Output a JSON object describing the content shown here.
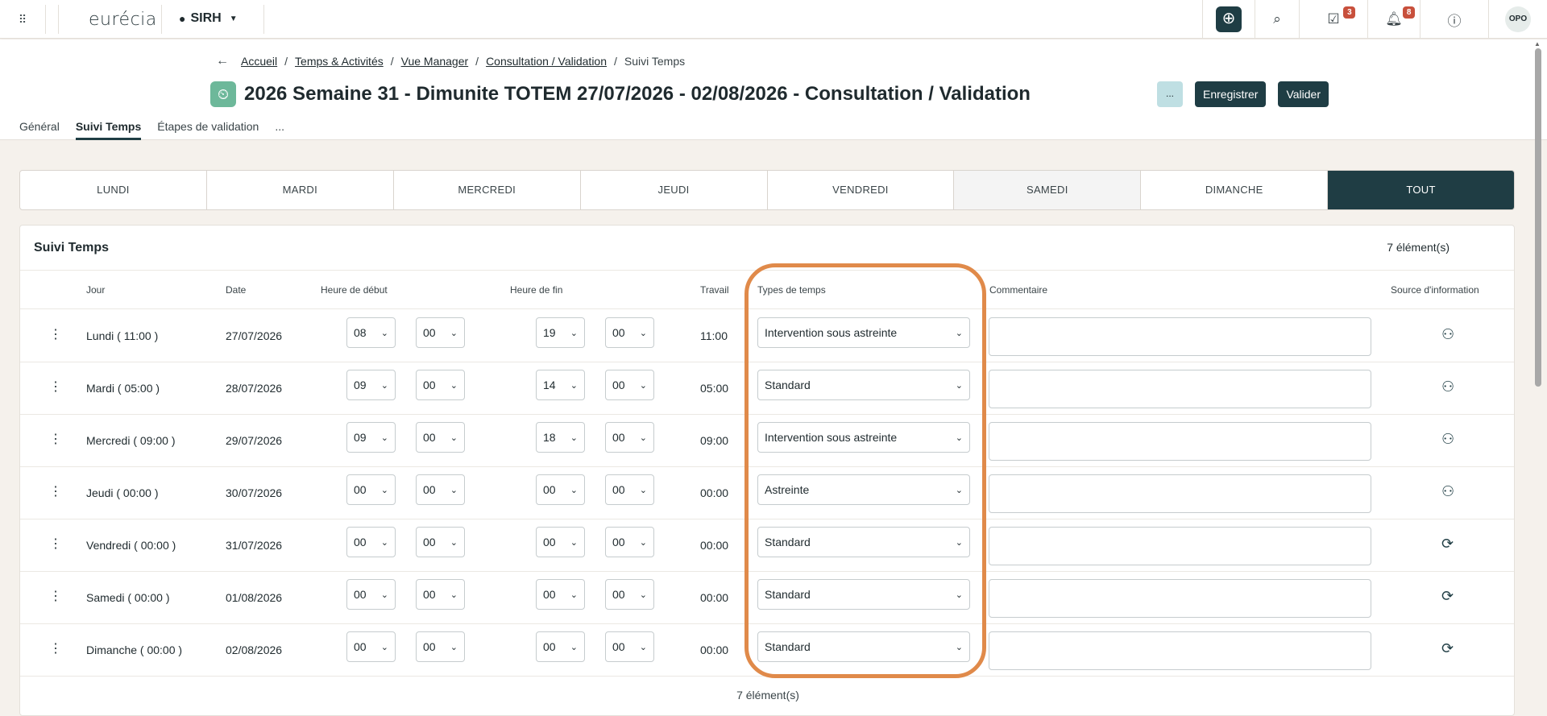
{
  "topbar": {
    "logo": "eurécia",
    "module": "SIRH",
    "tasks_badge": "3",
    "notif_badge": "8",
    "avatar": "OPO"
  },
  "breadcrumb": [
    "Accueil",
    "Temps & Activités",
    "Vue Manager",
    "Consultation / Validation",
    "Suivi Temps"
  ],
  "title": "2026 Semaine 31 - Dimunite TOTEM 27/07/2026 - 02/08/2026 - Consultation / Validation",
  "actions": {
    "more": "...",
    "save": "Enregistrer",
    "validate": "Valider"
  },
  "tabs": [
    "Général",
    "Suivi Temps",
    "Étapes de validation",
    "..."
  ],
  "days": [
    "LUNDI",
    "MARDI",
    "MERCREDI",
    "JEUDI",
    "VENDREDI",
    "SAMEDI",
    "DIMANCHE",
    "TOUT"
  ],
  "panel": {
    "title": "Suivi Temps",
    "count": "7 élément(s)",
    "footer": "7 élément(s)"
  },
  "columns": [
    "Jour",
    "Date",
    "Heure de début",
    "Heure de fin",
    "Travail",
    "Types de temps",
    "Commentaire",
    "Source d'information"
  ],
  "rows": [
    {
      "jour": "Lundi ( 11:00 )",
      "date": "27/07/2026",
      "sh": "08",
      "sm": "00",
      "eh": "19",
      "em": "00",
      "travail": "11:00",
      "type": "Intervention sous astreinte",
      "source": "person-icon"
    },
    {
      "jour": "Mardi ( 05:00 )",
      "date": "28/07/2026",
      "sh": "09",
      "sm": "00",
      "eh": "14",
      "em": "00",
      "travail": "05:00",
      "type": "Standard",
      "source": "person-icon"
    },
    {
      "jour": "Mercredi ( 09:00 )",
      "date": "29/07/2026",
      "sh": "09",
      "sm": "00",
      "eh": "18",
      "em": "00",
      "travail": "09:00",
      "type": "Intervention sous astreinte",
      "source": "person-icon"
    },
    {
      "jour": "Jeudi ( 00:00 )",
      "date": "30/07/2026",
      "sh": "00",
      "sm": "00",
      "eh": "00",
      "em": "00",
      "travail": "00:00",
      "type": "Astreinte",
      "source": "person-icon"
    },
    {
      "jour": "Vendredi ( 00:00 )",
      "date": "31/07/2026",
      "sh": "00",
      "sm": "00",
      "eh": "00",
      "em": "00",
      "travail": "00:00",
      "type": "Standard",
      "source": "sync-icon"
    },
    {
      "jour": "Samedi ( 00:00 )",
      "date": "01/08/2026",
      "sh": "00",
      "sm": "00",
      "eh": "00",
      "em": "00",
      "travail": "00:00",
      "type": "Standard",
      "source": "sync-icon"
    },
    {
      "jour": "Dimanche ( 00:00 )",
      "date": "02/08/2026",
      "sh": "00",
      "sm": "00",
      "eh": "00",
      "em": "00",
      "travail": "00:00",
      "type": "Standard",
      "source": "sync-icon"
    }
  ],
  "colors": {
    "primary": "#1f3d44",
    "highlight": "#e08a4a",
    "badge": "#c8503c"
  }
}
